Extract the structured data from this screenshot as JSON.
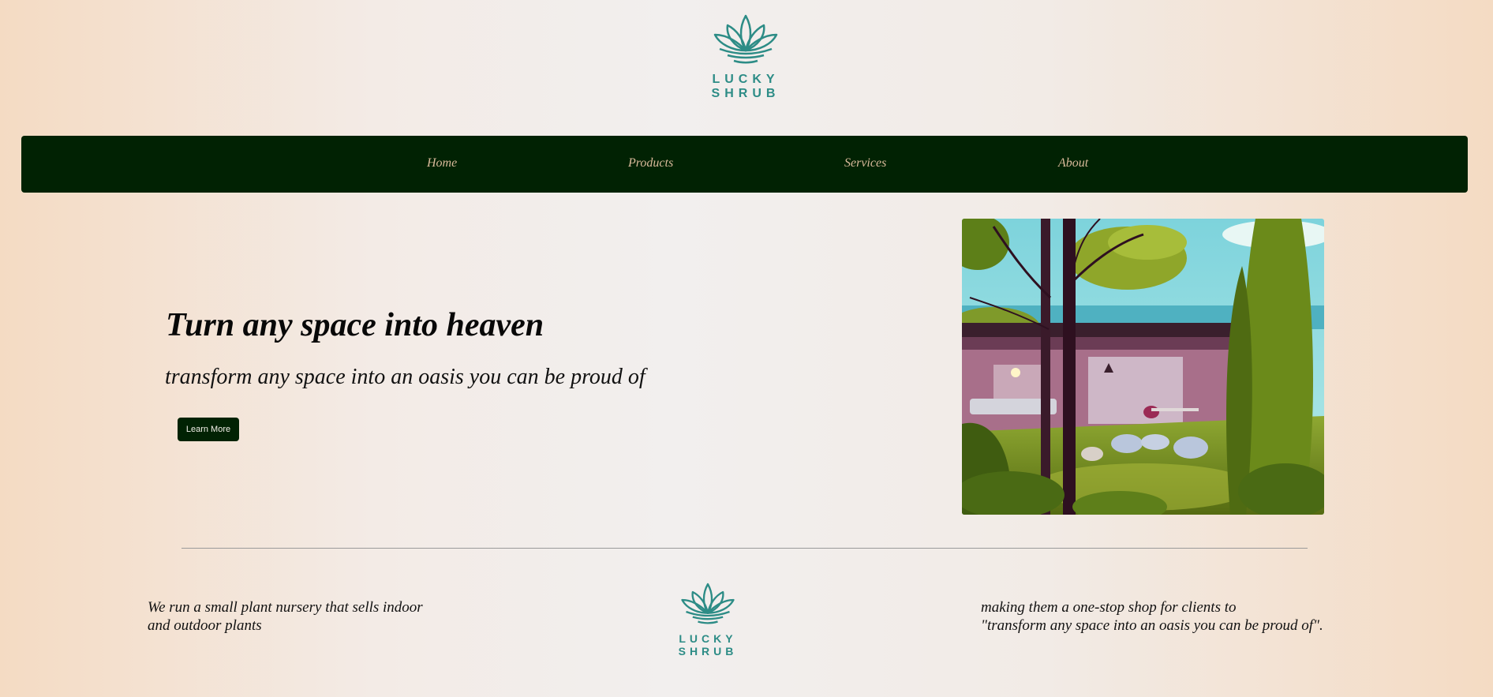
{
  "brand": {
    "logo_line1": "LUCKY",
    "logo_line2": "SHRUB",
    "color": "#2d8c86"
  },
  "nav": {
    "items": [
      {
        "label": "Home"
      },
      {
        "label": "Products"
      },
      {
        "label": "Services"
      },
      {
        "label": "About"
      }
    ],
    "background": "#012203",
    "text_color": "#d9b99a"
  },
  "hero": {
    "title": "Turn any space into heaven",
    "subtitle": "transform any space into an oasis you can be proud of",
    "button_label": "Learn More",
    "image_icon": "modern-garden-house-illustration"
  },
  "footer": {
    "left_line1": "We run a small plant nursery that sells indoor",
    "left_line2": "and outdoor plants",
    "right_line1": "making them a one-stop shop for clients to",
    "right_line2": "\"transform any space into an oasis you can be proud of\"."
  }
}
